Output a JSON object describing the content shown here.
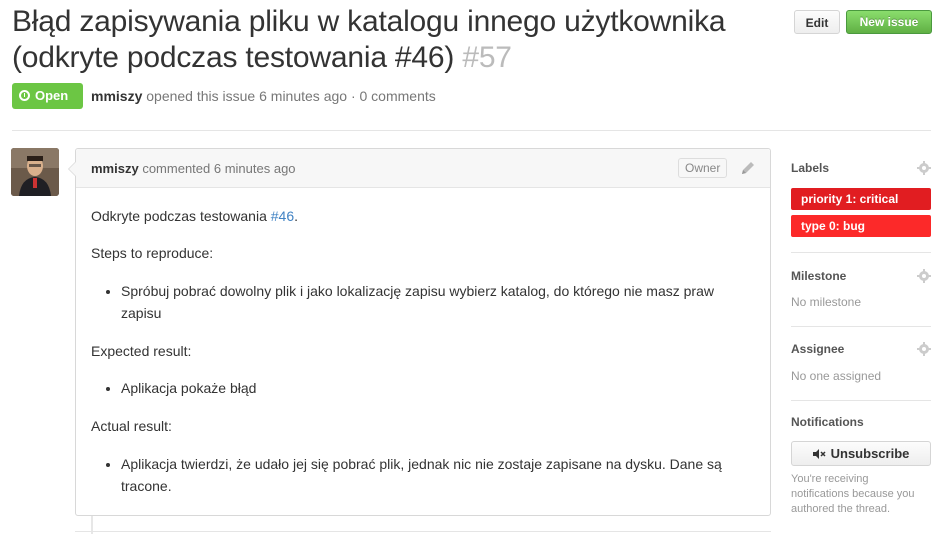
{
  "issue": {
    "title": "Błąd zapisywania pliku w katalogu innego użytkownika (odkryte podczas testowania #46)",
    "number": "#57",
    "state": "Open",
    "author": "mmiszy",
    "meta_rest": "opened this issue 6 minutes ago · 0 comments"
  },
  "header_buttons": {
    "edit": "Edit",
    "new_issue": "New issue"
  },
  "comment": {
    "author": "mmiszy",
    "action": "commented 6 minutes ago",
    "role_badge": "Owner",
    "intro_text": "Odkryte podczas testowania ",
    "intro_link": "#46",
    "intro_end": ".",
    "steps_heading": "Steps to reproduce:",
    "steps": [
      "Spróbuj pobrać dowolny plik i jako lokalizację zapisu wybierz katalog, do którego nie masz praw zapisu"
    ],
    "expected_heading": "Expected result:",
    "expected": [
      "Aplikacja pokaże błąd"
    ],
    "actual_heading": "Actual result:",
    "actual": [
      "Aplikacja twierdzi, że udało jej się pobrać plik, jednak nic nie zostaje zapisane na dysku. Dane są tracone."
    ]
  },
  "sidebar": {
    "labels_heading": "Labels",
    "labels": [
      {
        "name": "priority 1: critical",
        "color": "#e11d21"
      },
      {
        "name": "type 0: bug",
        "color": "#fc2929"
      }
    ],
    "milestone_heading": "Milestone",
    "milestone_value": "No milestone",
    "assignee_heading": "Assignee",
    "assignee_value": "No one assigned",
    "notifications_heading": "Notifications",
    "unsubscribe_label": "Unsubscribe",
    "notifications_note": "You're receiving notifications because you authored the thread."
  },
  "icons": {
    "state": "issue-opened-icon",
    "edit": "pencil-icon",
    "settings": "gear-icon",
    "mute": "mute-icon"
  },
  "colors": {
    "open_green": "#6cc644",
    "link": "#4183c4",
    "issue_number": "#bbbbbb"
  }
}
